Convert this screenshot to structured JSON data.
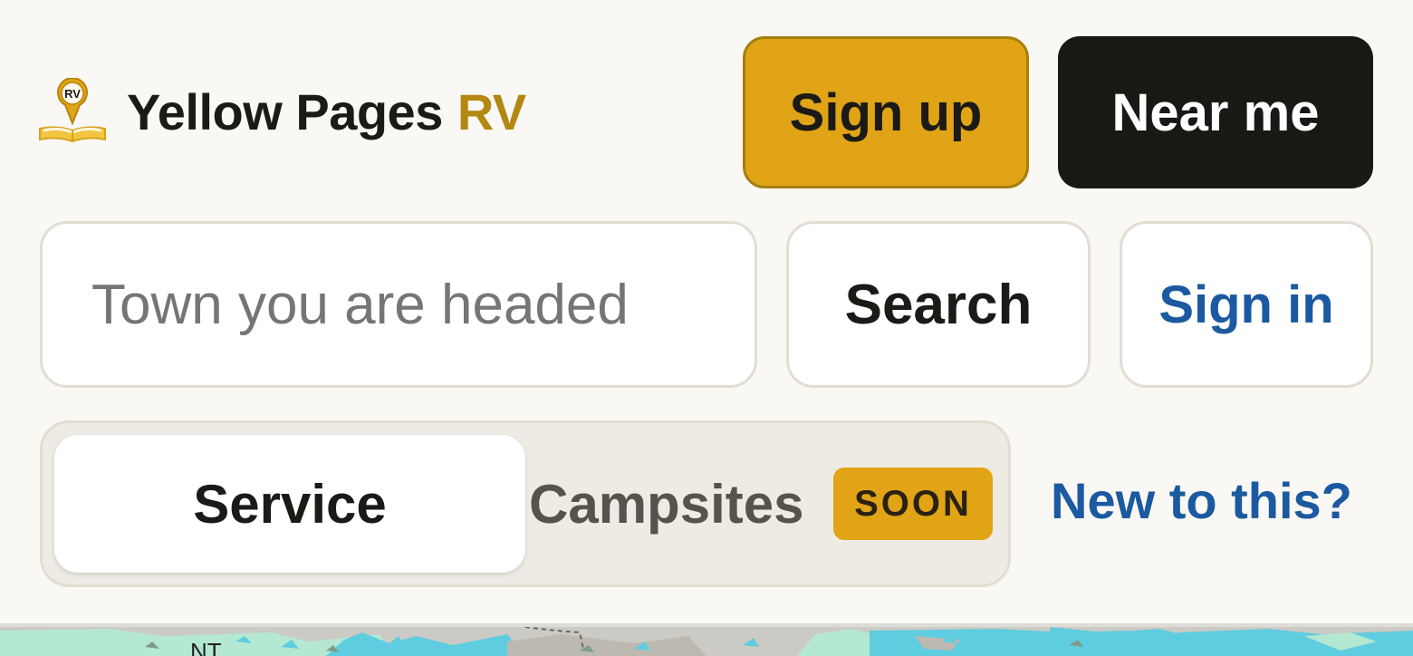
{
  "brand": {
    "name": "Yellow Pages",
    "accent": "RV",
    "logo_text": "RV",
    "logo_icon": "map-pin-book-icon"
  },
  "header": {
    "signup_label": "Sign up",
    "nearme_label": "Near me"
  },
  "search": {
    "placeholder": "Town you are headed",
    "value": "",
    "button_label": "Search"
  },
  "signin_label": "Sign in",
  "modes": {
    "service_label": "Service",
    "campsites_label": "Campsites",
    "campsites_badge": "SOON",
    "selected": "Service"
  },
  "help_link": "New to this?",
  "map": {
    "label": "NT"
  },
  "colors": {
    "background": "#faf8f4",
    "accent_yellow": "#e0a416",
    "accent_text": "#b28712",
    "dark": "#191815",
    "link_blue": "#1b5aa0",
    "map_water": "#5fcde0",
    "map_land": "#b4e8d2",
    "map_grey": "#cbcac4"
  }
}
